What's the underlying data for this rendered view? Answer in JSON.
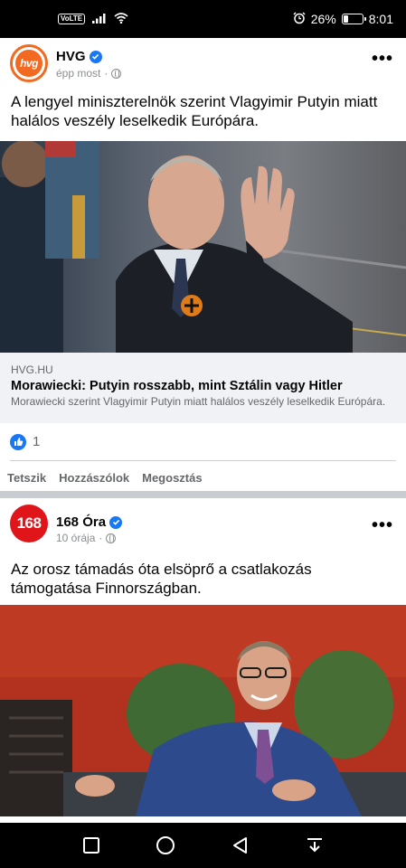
{
  "status_bar": {
    "network_badge": "VoLTE",
    "battery": "26%",
    "battery_level": 0.26,
    "time": "8:01",
    "icons": [
      "signal-icon",
      "wifi-icon",
      "alarm-icon",
      "battery-icon"
    ]
  },
  "posts": [
    {
      "page_name": "HVG",
      "avatar_text": "hvg",
      "time": "épp most",
      "text": "A lengyel miniszterelnök szerint Vlagyimir Putyin miatt halálos veszély leselkedik Európára.",
      "link": {
        "domain": "HVG.HU",
        "title": "Morawiecki: Putyin rosszabb, mint Sztálin vagy Hitler",
        "description": "Morawiecki szerint Vlagyimir Putyin miatt halálos veszély leselkedik Európára."
      },
      "reaction_count": "1",
      "actions": {
        "like": "Tetszik",
        "comment": "Hozzászólok",
        "share": "Megosztás"
      }
    },
    {
      "page_name": "168 Óra",
      "avatar_text": "168",
      "time": "10 órája",
      "text": "Az orosz támadás óta elsöprő a csatlakozás támogatása Finnországban."
    }
  ],
  "nav_bar": {
    "buttons": [
      "recent-apps-icon",
      "home-icon",
      "back-icon",
      "notification-pull-icon"
    ]
  },
  "colors": {
    "facebook_blue": "#1877f2",
    "hvg_orange": "#f26a21",
    "ora168_red": "#e0151a"
  }
}
